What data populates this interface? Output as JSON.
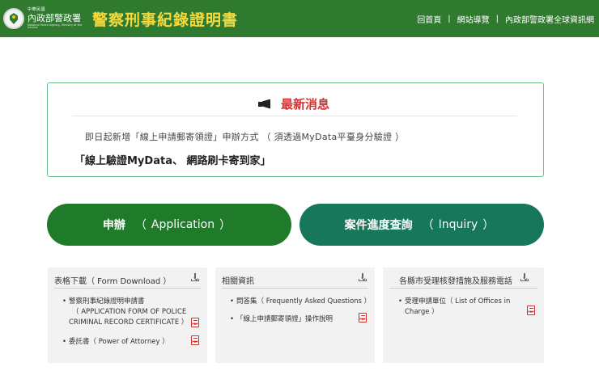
{
  "header": {
    "logo_line1": "中華民國",
    "logo_line2": "內政部警政署",
    "logo_en": "National Police Agency, Ministry of the Interior",
    "site_title": "警察刑事紀錄證明書",
    "nav": [
      "回首頁",
      "網站導覽",
      "內政部警政署全球資訊網"
    ],
    "nav_sep": "|"
  },
  "news": {
    "title": "最新消息",
    "text": "即日起新增「線上申請郵寄領證」申辦方式 （ 須透過MyData平臺身分驗證 ）",
    "sub": "「線上驗證MyData、 網路刷卡寄到家」"
  },
  "buttons": {
    "apply": {
      "label": "申辦",
      "open": "（",
      "en": "Application",
      "close": "）"
    },
    "inquiry": {
      "label": "案件進度查詢",
      "open": "（",
      "en": "Inquiry",
      "close": "）"
    }
  },
  "panels": {
    "forms": {
      "title": "表格下載（ Form Download ）",
      "items": [
        {
          "text1": "警察刑事紀錄證明申請書",
          "text2": "（ APPLICATION FORM OF POLICE",
          "text3": "CRIMINAL RECORD CERTIFICATE ）"
        },
        {
          "text1": "委託書（ Power of Attorney ）"
        }
      ]
    },
    "info": {
      "title": "相關資訊",
      "items": [
        {
          "text": "問答集（ Frequently Asked Questions ）"
        },
        {
          "text": "「線上申請郵寄領證」操作說明"
        }
      ]
    },
    "offices": {
      "title": "各縣市受理核發措施及服務電話",
      "items": [
        {
          "text1": "受理申請單位（ List of Offices in",
          "text2": "Charge ）"
        }
      ]
    }
  },
  "bullet": "•",
  "colors": {
    "header_bg": "#2f7a2f",
    "title_yellow": "#f6d93b",
    "news_red": "#d32f2f",
    "apply_green": "#1f7a2a",
    "inquiry_green": "#16775a"
  },
  "icons": [
    "seal-logo-icon",
    "megaphone-icon",
    "download-icon",
    "pdf-icon"
  ]
}
